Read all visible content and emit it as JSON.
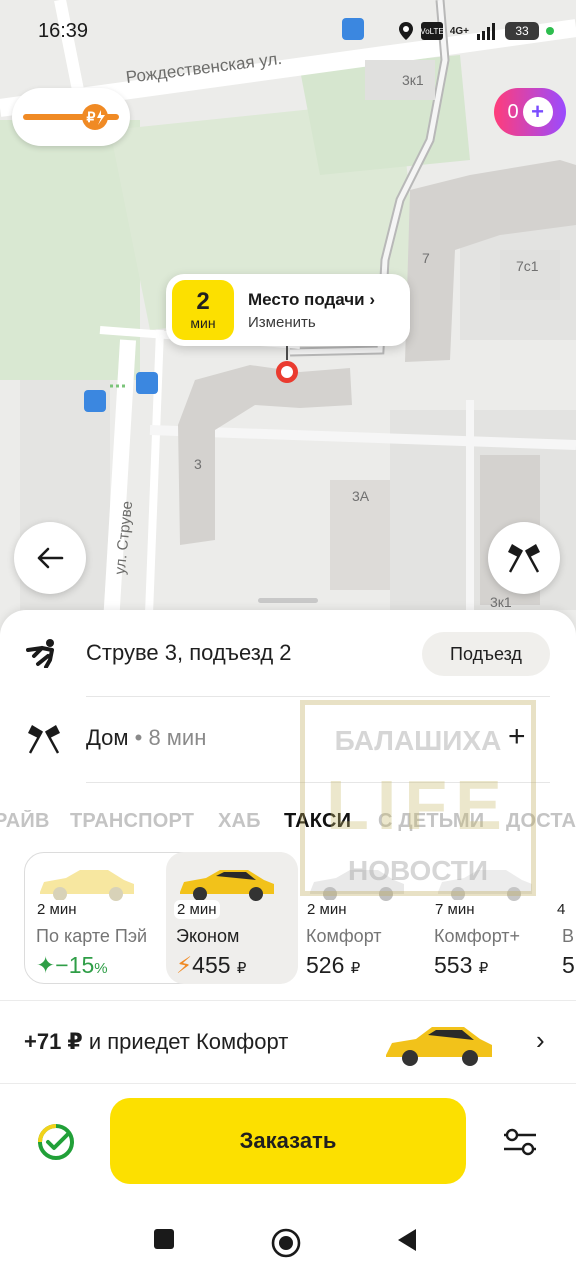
{
  "status_bar": {
    "time": "16:39",
    "battery": "33",
    "network": "4G+"
  },
  "map": {
    "streets": [
      "Рождественская ул.",
      "ул. Струве"
    ],
    "house_numbers": [
      "3к1",
      "7",
      "7с1",
      "3",
      "3А",
      "3к1"
    ],
    "balance_badge": "0",
    "icons": [
      "ruble-lightning-icon",
      "plus-icon",
      "back-arrow-icon",
      "checkered-flags-icon",
      "pin-icon"
    ]
  },
  "pickup": {
    "eta_value": "2",
    "eta_unit": "мин",
    "title": "Место подачи",
    "subtitle": "Изменить"
  },
  "route": {
    "from": "Струве 3, подъезд 2",
    "entrance_button": "Подъезд",
    "to": "Дом",
    "to_time": "8 мин",
    "separator": " • ",
    "add": "+"
  },
  "tabs": [
    "РАЙВ",
    "ТРАНСПОРТ",
    "ХАБ",
    "ТАКСИ",
    "С ДЕТЬМИ",
    "ДОСТА"
  ],
  "active_tab": "ТАКСИ",
  "tariffs": [
    {
      "eta": "2 мин",
      "name": "По карте Пэй",
      "price": "−15",
      "unit": "%",
      "selected": false
    },
    {
      "eta": "2 мин",
      "name": "Эконом",
      "price": "455",
      "unit": "₽",
      "selected": true
    },
    {
      "eta": "2 мин",
      "name": "Комфорт",
      "price": "526",
      "unit": "₽",
      "selected": false
    },
    {
      "eta": "7 мин",
      "name": "Комфорт+",
      "price": "553",
      "unit": "₽",
      "selected": false
    },
    {
      "eta": "4",
      "name": "В",
      "price": "5",
      "unit": "",
      "selected": false
    }
  ],
  "upsell": {
    "amount": "+71 ₽",
    "text": " и приедет Комфорт",
    "chevron": "›"
  },
  "order": {
    "button": "Заказать"
  },
  "watermark": {
    "line1": "БАЛАШИХА",
    "line2": "LIFE",
    "line3": "НОВОСТИ"
  },
  "colors": {
    "yellow": "#fce000",
    "pin_red": "#ea3b2f",
    "discount_green": "#2f9e47",
    "plus_gradient": [
      "#ff3d7a",
      "#9a4bff"
    ]
  }
}
